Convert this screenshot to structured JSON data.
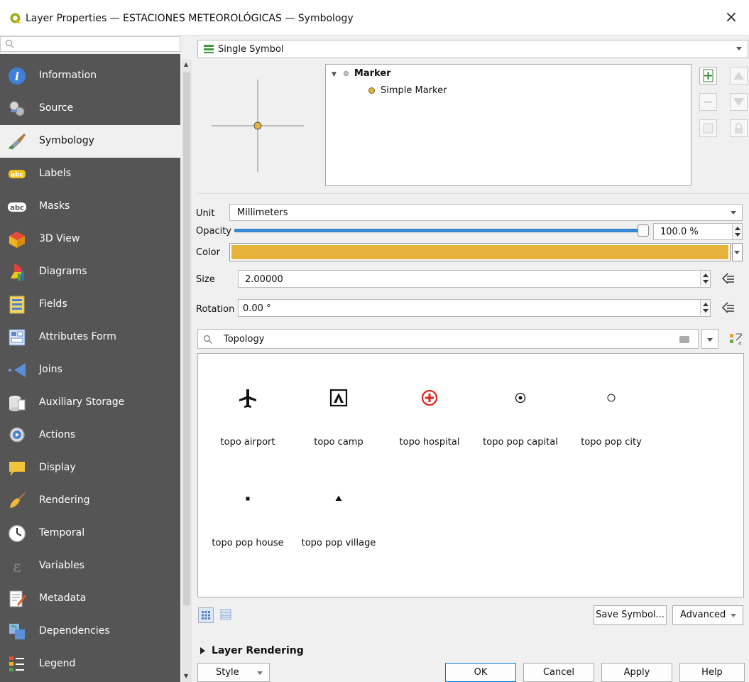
{
  "window": {
    "title": "Layer Properties — ESTACIONES METEOROLÓGICAS — Symbology",
    "close_glyph": "×"
  },
  "sidebar": {
    "search_placeholder": "",
    "items": [
      {
        "label": "Information",
        "icon": "info-icon",
        "active": false
      },
      {
        "label": "Source",
        "icon": "source-icon",
        "active": false
      },
      {
        "label": "Symbology",
        "icon": "paintbrush-icon",
        "active": true
      },
      {
        "label": "Labels",
        "icon": "labels-icon",
        "active": false
      },
      {
        "label": "Masks",
        "icon": "masks-icon",
        "active": false
      },
      {
        "label": "3D View",
        "icon": "cube-icon",
        "active": false
      },
      {
        "label": "Diagrams",
        "icon": "diagrams-icon",
        "active": false
      },
      {
        "label": "Fields",
        "icon": "fields-icon",
        "active": false
      },
      {
        "label": "Attributes Form",
        "icon": "form-icon",
        "active": false
      },
      {
        "label": "Joins",
        "icon": "joins-icon",
        "active": false
      },
      {
        "label": "Auxiliary Storage",
        "icon": "storage-icon",
        "active": false
      },
      {
        "label": "Actions",
        "icon": "actions-icon",
        "active": false
      },
      {
        "label": "Display",
        "icon": "speech-bubble-icon",
        "active": false
      },
      {
        "label": "Rendering",
        "icon": "brush-icon",
        "active": false
      },
      {
        "label": "Temporal",
        "icon": "clock-icon",
        "active": false
      },
      {
        "label": "Variables",
        "icon": "variables-icon",
        "active": false
      },
      {
        "label": "Metadata",
        "icon": "metadata-icon",
        "active": false
      },
      {
        "label": "Dependencies",
        "icon": "dependencies-icon",
        "active": false
      },
      {
        "label": "Legend",
        "icon": "legend-icon",
        "active": false
      }
    ]
  },
  "renderer": {
    "selected": "Single Symbol"
  },
  "symbol_tree": {
    "root": "Marker",
    "child": "Simple Marker"
  },
  "props": {
    "unit_label": "Unit",
    "unit_value": "Millimeters",
    "opacity_label": "Opacity",
    "opacity_value": "100.0 %",
    "opacity_fraction": 1.0,
    "color_label": "Color",
    "color_value": "#e6b43a",
    "size_label": "Size",
    "size_value": "2.00000",
    "rotation_label": "Rotation",
    "rotation_value": "0.00 °"
  },
  "search": {
    "value": "Topology"
  },
  "gallery": [
    {
      "name": "topo airport",
      "icon": "airplane-icon"
    },
    {
      "name": "topo camp",
      "icon": "camp-icon"
    },
    {
      "name": "topo hospital",
      "icon": "hospital-icon"
    },
    {
      "name": "topo pop capital",
      "icon": "capital-icon"
    },
    {
      "name": "topo pop city",
      "icon": "city-icon"
    },
    {
      "name": "topo pop house",
      "icon": "house-icon"
    },
    {
      "name": "topo pop village",
      "icon": "village-icon"
    }
  ],
  "buttons": {
    "save_symbol": "Save Symbol...",
    "advanced": "Advanced",
    "style": "Style",
    "ok": "OK",
    "cancel": "Cancel",
    "apply": "Apply",
    "help": "Help"
  },
  "layer_rendering": "Layer Rendering",
  "colors": {
    "sidebar_bg": "#555555",
    "accent": "#3c8fdc",
    "marker_fill": "#e6b43a"
  }
}
